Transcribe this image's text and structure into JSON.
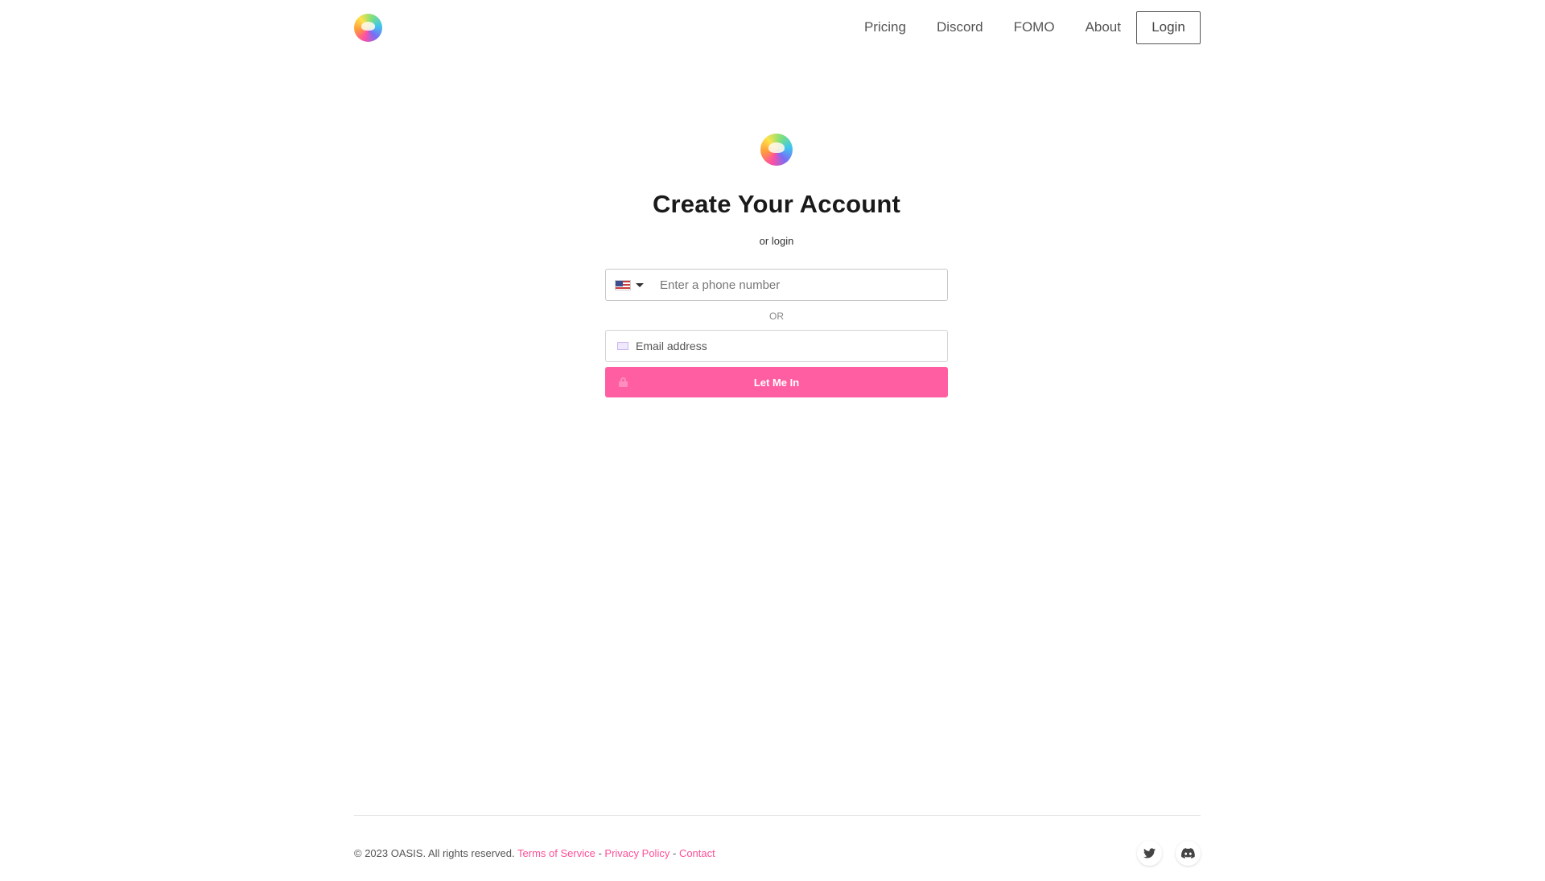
{
  "header": {
    "nav": [
      "Pricing",
      "Discord",
      "FOMO",
      "About"
    ],
    "login_label": "Login"
  },
  "main": {
    "title": "Create Your Account",
    "subtitle": "or login",
    "phone_placeholder": "Enter a phone number",
    "country_flag": "us-flag-icon",
    "or_text": "OR",
    "email_placeholder": "Email address",
    "submit_label": "Let Me In"
  },
  "footer": {
    "copyright": "© 2023 OASIS. All rights reserved.",
    "terms": "Terms of Service",
    "sep1": "-",
    "privacy": "Privacy Policy",
    "sep2": "-",
    "contact": "Contact",
    "social_icons": [
      "twitter-icon",
      "discord-icon"
    ]
  },
  "colors": {
    "accent": "#ff5fa2",
    "link": "#ff4f98"
  }
}
